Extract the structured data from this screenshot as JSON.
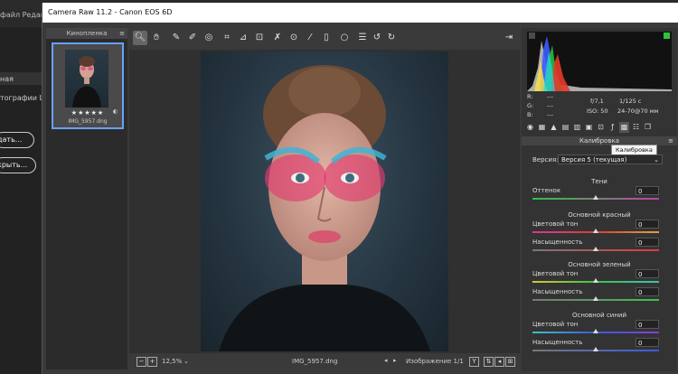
{
  "host": {
    "menu": "файл  Редактирование",
    "label_a": "ная",
    "label_b": "тографии LR",
    "button_a": "дать...",
    "button_b": "крыть..."
  },
  "window": {
    "title": "Camera Raw 11.2  -  Canon EOS 6D"
  },
  "filmstrip": {
    "header": "Кинопленка",
    "stars": "★★★★★",
    "filename": "IMG_5957.dng"
  },
  "status": {
    "zoom": "12,5%",
    "filename": "IMG_5957.dng",
    "image_counter": "Изображение 1/1"
  },
  "info": {
    "r_label": "R:",
    "g_label": "G:",
    "b_label": "B:",
    "r_val": "---",
    "g_val": "---",
    "b_val": "---",
    "aperture": "f/7,1",
    "shutter": "1/125 с",
    "iso": "ISO: 50",
    "lens": "24-70@70 мм"
  },
  "panel": {
    "title": "Калибровка",
    "tooltip": "Калибровка",
    "version_label": "Версия:",
    "version_value": "Версия 5 (текущая)",
    "shadows_title": "Тени",
    "tint_label": "Оттенок",
    "tint_value": "0",
    "red_title": "Основной красный",
    "red_hue_label": "Цветовой тон",
    "red_hue_value": "0",
    "red_sat_label": "Насыщенность",
    "red_sat_value": "0",
    "green_title": "Основной зеленый",
    "green_hue_label": "Цветовой тон",
    "green_hue_value": "0",
    "green_sat_label": "Насыщенность",
    "green_sat_value": "0",
    "blue_title": "Основной синий",
    "blue_hue_label": "Цветовой тон",
    "blue_hue_value": "0",
    "blue_sat_label": "Насыщенность",
    "blue_sat_value": "0"
  }
}
